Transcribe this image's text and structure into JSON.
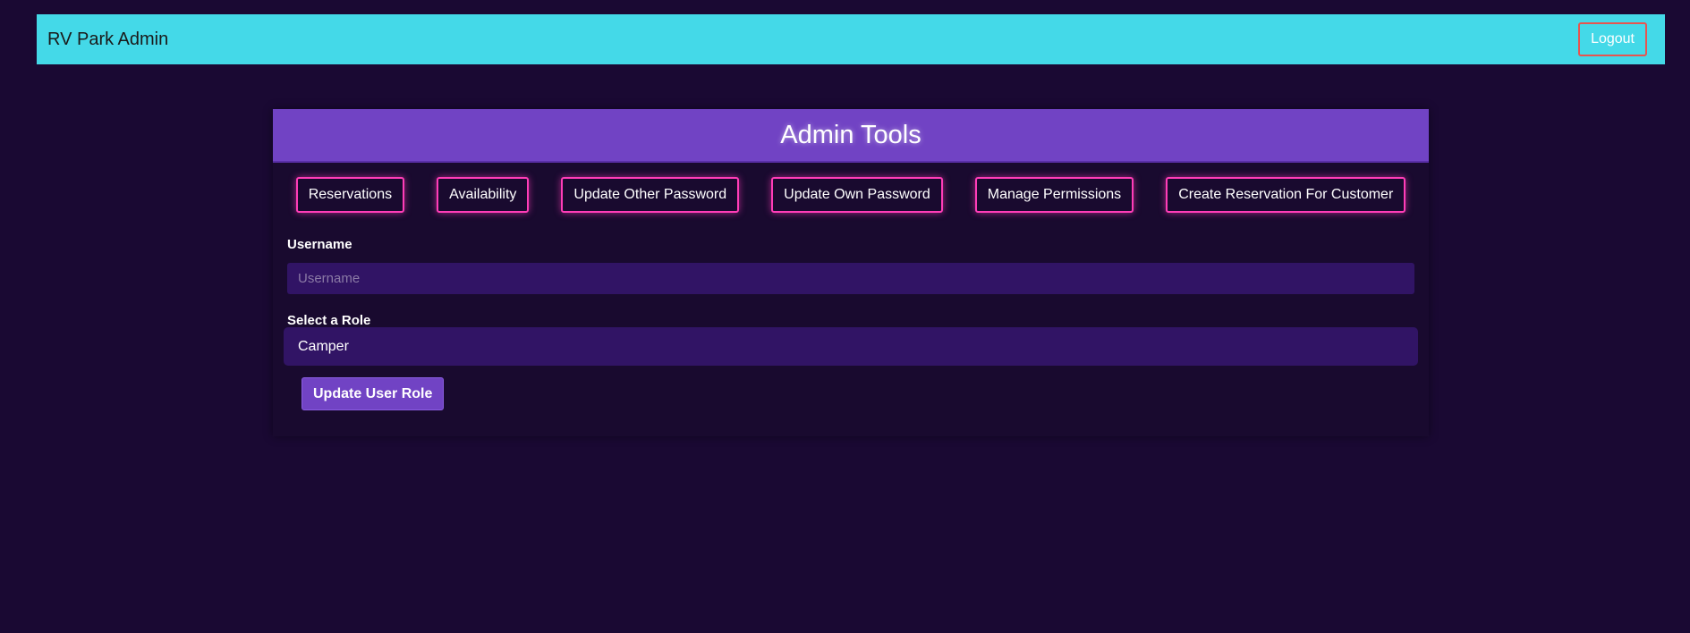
{
  "navbar": {
    "brand": "RV Park Admin",
    "logout_label": "Logout"
  },
  "panel": {
    "title": "Admin Tools",
    "tools": [
      {
        "label": "Reservations"
      },
      {
        "label": "Availability"
      },
      {
        "label": "Update Other Password"
      },
      {
        "label": "Update Own Password"
      },
      {
        "label": "Manage Permissions"
      },
      {
        "label": "Create Reservation For Customer"
      }
    ]
  },
  "form": {
    "username_label": "Username",
    "username_placeholder": "Username",
    "username_value": "",
    "role_label": "Select a Role",
    "role_selected": "Camper",
    "submit_label": "Update User Role"
  },
  "colors": {
    "background": "#1a0933",
    "navbar": "#44d9e8",
    "accent": "#7143c4",
    "tool_border": "#ff3db8",
    "logout_border": "#e8544f"
  }
}
